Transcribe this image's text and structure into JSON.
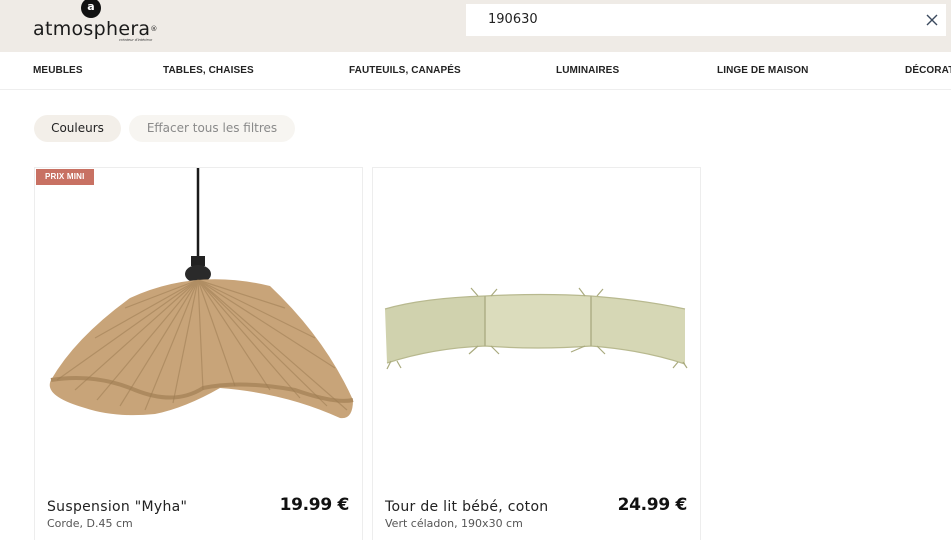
{
  "brand": {
    "logo_letter": "a",
    "name": "atmosphera",
    "tagline": "créateur d'intérieur",
    "mark": "®"
  },
  "search": {
    "value": "190630",
    "clear_icon": "close-icon"
  },
  "nav": {
    "items": [
      {
        "label": "MEUBLES"
      },
      {
        "label": "TABLES, CHAISES"
      },
      {
        "label": "FAUTEUILS, CANAPÉS"
      },
      {
        "label": "LUMINAIRES"
      },
      {
        "label": "LINGE DE MAISON"
      },
      {
        "label": "DÉCORATION"
      }
    ]
  },
  "filters": {
    "colors_label": "Couleurs",
    "clear_label": "Effacer tous les filtres"
  },
  "products": [
    {
      "badge": "PRIX MINI",
      "name": "Suspension \"Myha\"",
      "subtitle": "Corde, D.45 cm",
      "price": "19.99 €",
      "image": "rope-pendant-lamp"
    },
    {
      "name": "Tour de lit bébé, coton",
      "subtitle": "Vert céladon, 190x30 cm",
      "price": "24.99 €",
      "image": "baby-bed-bumper"
    }
  ],
  "colors": {
    "header_bg": "#efebe6",
    "badge_bg": "#c87163",
    "chip_bg": "#f3efe9"
  }
}
